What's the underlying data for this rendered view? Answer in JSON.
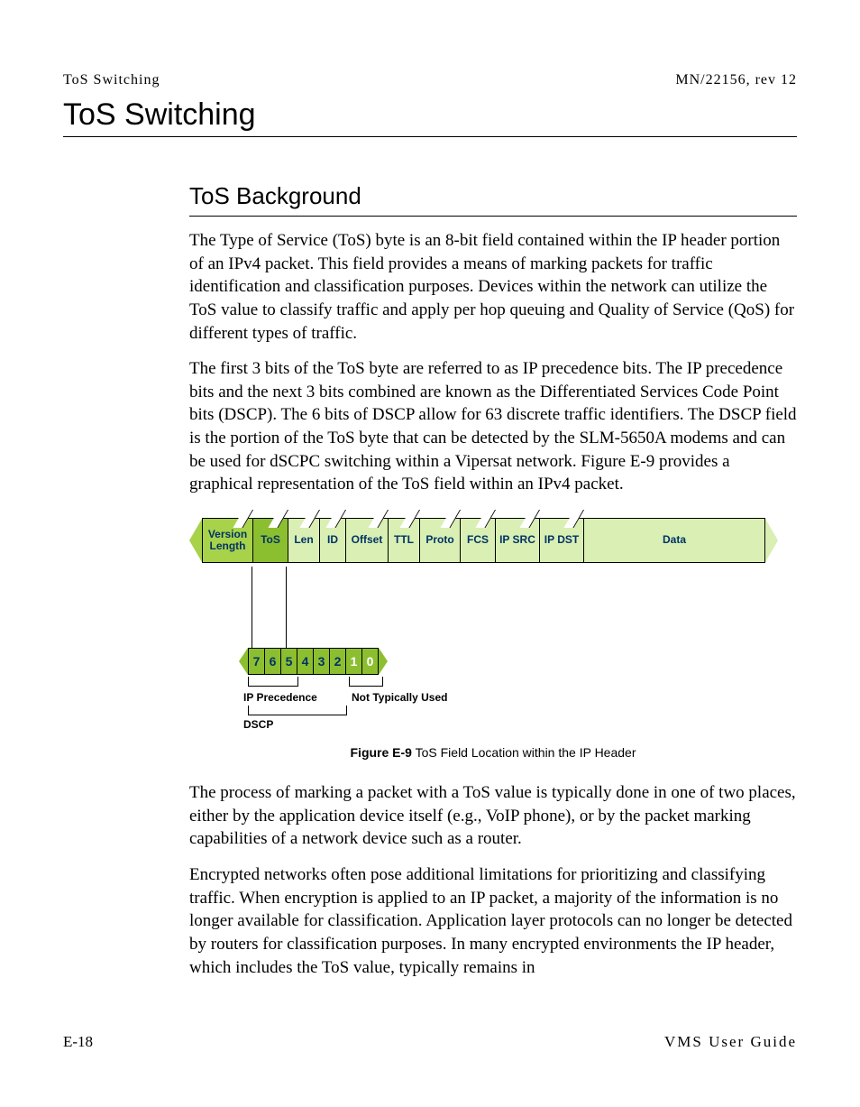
{
  "header": {
    "left": "ToS Switching",
    "right": "MN/22156, rev 12"
  },
  "title": "ToS Switching",
  "section": {
    "heading": "ToS Background",
    "p1": "The Type of Service (ToS) byte is an 8-bit field contained within the IP header portion of an IPv4 packet. This field provides a means of marking packets for traffic identification and classification purposes. Devices within the network can utilize the ToS value to classify traffic and apply per hop queuing and Quality of Service (QoS) for different types of traffic.",
    "p2": "The first 3 bits of the ToS byte are referred to as IP precedence bits. The IP precedence bits and the next 3 bits combined are known as the Differentiated Services Code Point bits (DSCP). The 6 bits of DSCP allow for 63 discrete traffic identifiers. The DSCP field is the portion of the ToS byte that can be detected by the SLM-5650A modems and can be used for dSCPC switching within a Vipersat network. Figure E-9 provides a graphical representation of the ToS field within an IPv4 packet.",
    "p3": "The process of marking a packet with a ToS value is typically done in one of two places, either by the application device itself (e.g., VoIP phone), or by the packet marking capabilities of a network device such as a router.",
    "p4": "Encrypted networks often pose additional limitations for prioritizing and classifying traffic. When encryption is applied to an IP packet, a majority of the information is no longer available for classification. Application layer protocols can no longer be detected by routers for classification purposes. In many encrypted environments the IP header, which includes the ToS value, typically remains in"
  },
  "figure": {
    "fields": [
      "Version\nLength",
      "ToS",
      "Len",
      "ID",
      "Offset",
      "TTL",
      "Proto",
      "FCS",
      "IP SRC",
      "IP DST",
      "Data"
    ],
    "bits": [
      "7",
      "6",
      "5",
      "4",
      "3",
      "2",
      "1",
      "0"
    ],
    "labels": {
      "ip_precedence": "IP Precedence",
      "not_used": "Not Typically Used",
      "dscp": "DSCP"
    },
    "caption_bold": "Figure E-9",
    "caption_rest": "   ToS Field Location within the IP Header"
  },
  "footer": {
    "left": "E-18",
    "right": "VMS User Guide"
  }
}
